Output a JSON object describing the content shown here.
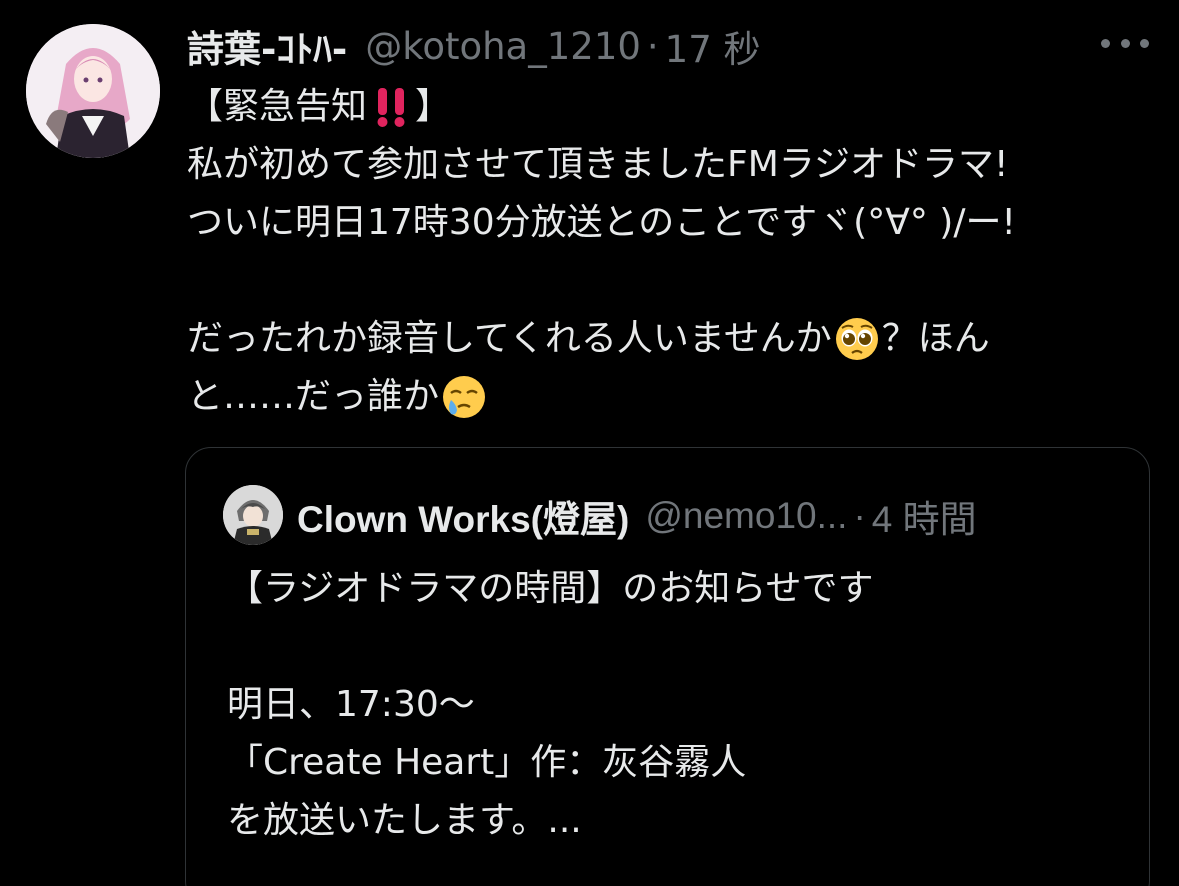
{
  "tweet": {
    "author": {
      "display_name": "詩葉-ｺﾄﾊ-",
      "handle": "@kotoha_1210",
      "avatar_icon": "user-avatar-icon"
    },
    "separator": "·",
    "timestamp": "17 秒",
    "more_icon": "ellipsis-icon",
    "lines": [
      {
        "text_before": "【緊急告知",
        "emoji": "double-exclamation-emoji",
        "text_after": "】"
      },
      {
        "text": "私が初めて参加させて頂きましたFMラジオドラマ!"
      },
      {
        "text": "ついに明日17時30分放送とのことですヾ(°∀° )/ー!"
      },
      {
        "text": ""
      },
      {
        "text_before": "だったれか録音してくれる人いませんか",
        "emoji": "pleading-face-emoji",
        "text_after": "？ほん"
      },
      {
        "text_before": "と……だっ誰か",
        "emoji": "face-holding-back-tears-emoji",
        "text_after": ""
      }
    ],
    "quoted": {
      "author": {
        "display_name": "Clown Works(燈屋)",
        "handle": "@nemo10...",
        "avatar_icon": "user-avatar-icon"
      },
      "separator": "·",
      "timestamp": "4 時間",
      "lines": [
        "【ラジオドラマの時間】のお知らせです",
        "",
        "明日、17:30〜",
        "「Create Heart」作：灰谷霧人",
        "を放送いたします。..."
      ]
    }
  },
  "colors": {
    "background": "#000000",
    "text_primary": "#e7e9ea",
    "text_secondary": "#71767b",
    "border": "#2f3336",
    "emoji_red": "#e0245e",
    "emoji_yellow": "#ffcc4d"
  }
}
